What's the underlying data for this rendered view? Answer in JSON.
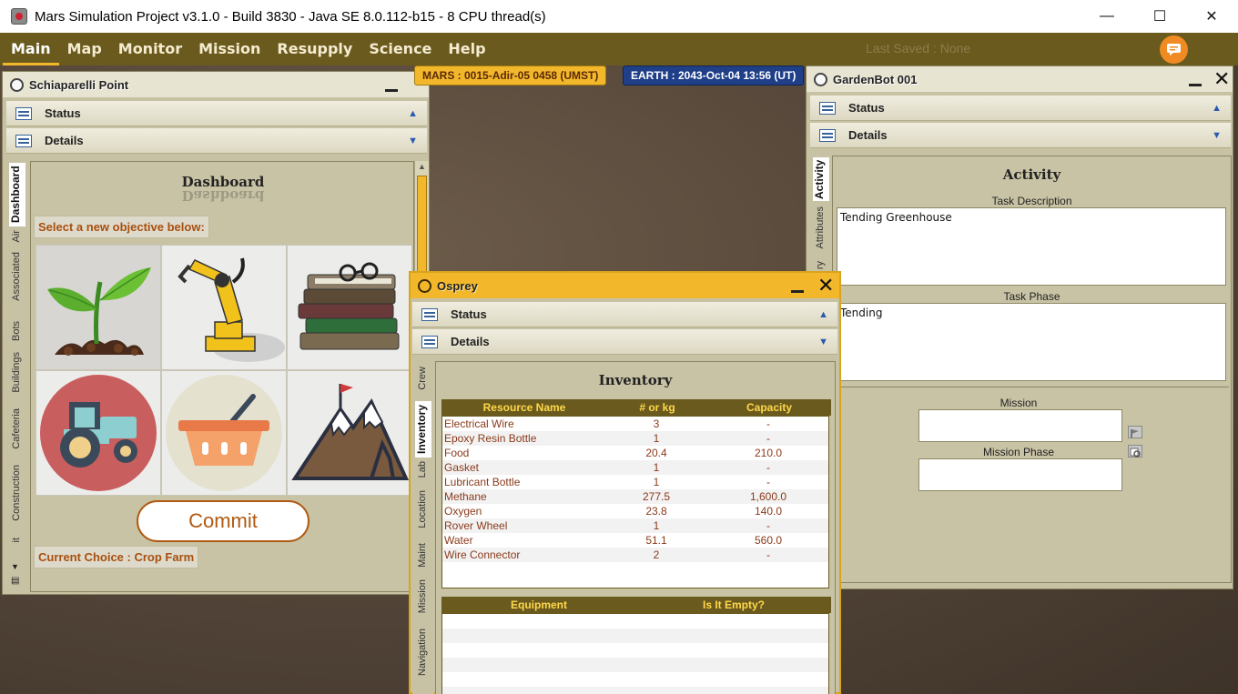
{
  "app": {
    "title": "Mars Simulation Project v3.1.0 - Build 3830 - Java SE 8.0.112-b15 - 8 CPU thread(s)",
    "window_controls": [
      "—",
      "☐",
      "✕"
    ]
  },
  "menubar": {
    "items": [
      "Main",
      "Map",
      "Monitor",
      "Mission",
      "Resupply",
      "Science",
      "Help"
    ],
    "active": "Main",
    "last_saved": "Last Saved : None",
    "chat_icon": "chat-bubble-icon"
  },
  "time": {
    "mars": "MARS  :  0015-Adir-05 0458 (UMST)",
    "earth": "EARTH  :  2043-Oct-04  13:56 (UT)"
  },
  "settlement": {
    "title": "Schiaparelli Point",
    "sections": {
      "status": "Status",
      "details": "Details"
    },
    "tabs": [
      "Dashboard",
      "Air",
      "Associated",
      "Bots",
      "Buildings",
      "Cafeteria",
      "Construction",
      "it"
    ],
    "active_tab": "Dashboard",
    "dashboard": {
      "heading": "Dashboard",
      "prompt": "Select a new objective below:",
      "objectives": [
        "Crop Farm",
        "Manufacturing",
        "Research",
        "Transportation",
        "Trade",
        "Tourism"
      ],
      "commit_label": "Commit",
      "current_choice": "Current Choice : Crop Farm"
    }
  },
  "gardenbot": {
    "title": "GardenBot 001",
    "sections": {
      "status": "Status",
      "details": "Details"
    },
    "tabs": [
      "Activity",
      "Attributes",
      "ry"
    ],
    "active_tab": "Activity",
    "activity": {
      "heading": "Activity",
      "task_description_label": "Task Description",
      "task_description": "Tending Greenhouse",
      "task_phase_label": "Task Phase",
      "task_phase": "Tending",
      "mission_label": "Mission",
      "mission": "",
      "mission_phase_label": "Mission Phase",
      "mission_phase": ""
    }
  },
  "osprey": {
    "title": "Osprey",
    "sections": {
      "status": "Status",
      "details": "Details"
    },
    "tabs": [
      "Crew",
      "Inventory",
      "Lab",
      "Location",
      "Maint",
      "Mission",
      "Navigation"
    ],
    "active_tab": "Inventory",
    "inventory": {
      "heading": "Inventory",
      "columns": [
        "Resource Name",
        "# or kg",
        "Capacity"
      ],
      "rows": [
        {
          "name": "Electrical Wire",
          "amount": "3",
          "capacity": "-"
        },
        {
          "name": "Epoxy Resin Bottle",
          "amount": "1",
          "capacity": "-"
        },
        {
          "name": "Food",
          "amount": "20.4",
          "capacity": "210.0"
        },
        {
          "name": "Gasket",
          "amount": "1",
          "capacity": "-"
        },
        {
          "name": "Lubricant Bottle",
          "amount": "1",
          "capacity": "-"
        },
        {
          "name": "Methane",
          "amount": "277.5",
          "capacity": "1,600.0"
        },
        {
          "name": "Oxygen",
          "amount": "23.8",
          "capacity": "140.0"
        },
        {
          "name": "Rover Wheel",
          "amount": "1",
          "capacity": "-"
        },
        {
          "name": "Water",
          "amount": "51.1",
          "capacity": "560.0"
        },
        {
          "name": "Wire Connector",
          "amount": "2",
          "capacity": "-"
        }
      ],
      "equipment_columns": [
        "Equipment",
        "Is It Empty?"
      ]
    }
  },
  "colors": {
    "menubar": "#6a5a1e",
    "accent": "#f2b72a",
    "panel": "#c7c2a4",
    "orange_text": "#a8500f",
    "earth_badge": "#1f3f88"
  }
}
